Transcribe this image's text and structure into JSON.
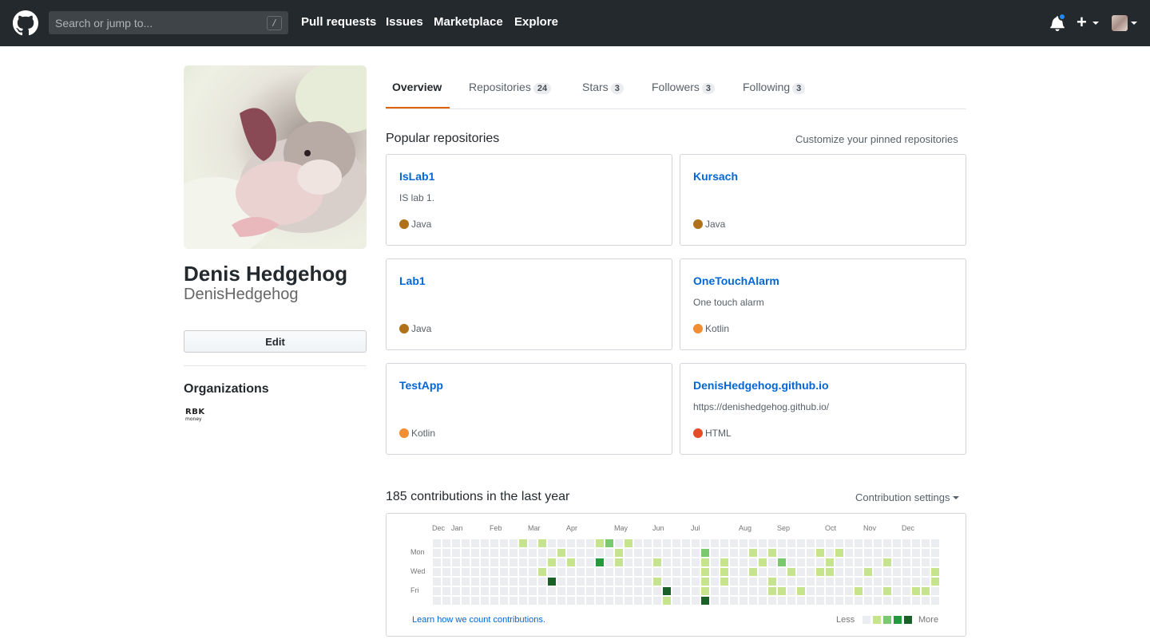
{
  "header": {
    "search_placeholder": "Search or jump to...",
    "search_shortcut": "/",
    "nav": [
      "Pull requests",
      "Issues",
      "Marketplace",
      "Explore"
    ],
    "plus_label": "+"
  },
  "profile": {
    "full_name": "Denis Hedgehog",
    "username": "DenisHedgehog",
    "edit_label": "Edit",
    "organizations_title": "Organizations",
    "org_logo_text": "RBK",
    "org_logo_sub": "money"
  },
  "tabs": [
    {
      "label": "Overview",
      "count": null
    },
    {
      "label": "Repositories",
      "count": "24"
    },
    {
      "label": "Stars",
      "count": "3"
    },
    {
      "label": "Followers",
      "count": "3"
    },
    {
      "label": "Following",
      "count": "3"
    }
  ],
  "popular": {
    "title": "Popular repositories",
    "customize_label": "Customize your pinned repositories",
    "repos": [
      {
        "name": "IsLab1",
        "description": "IS lab 1.",
        "language": "Java",
        "lang_color": "#b07219"
      },
      {
        "name": "Kursach",
        "description": "",
        "language": "Java",
        "lang_color": "#b07219"
      },
      {
        "name": "Lab1",
        "description": "",
        "language": "Java",
        "lang_color": "#b07219"
      },
      {
        "name": "OneTouchAlarm",
        "description": "One touch alarm",
        "language": "Kotlin",
        "lang_color": "#F18E33"
      },
      {
        "name": "TestApp",
        "description": "",
        "language": "Kotlin",
        "lang_color": "#F18E33"
      },
      {
        "name": "DenisHedgehog.github.io",
        "description": "https://denishedgehog.github.io/",
        "language": "HTML",
        "lang_color": "#e34c26"
      }
    ]
  },
  "contributions": {
    "title": "185 contributions in the last year",
    "settings_label": "Contribution settings",
    "months": [
      "Dec",
      "Jan",
      "Feb",
      "Mar",
      "Apr",
      "May",
      "Jun",
      "Jul",
      "Aug",
      "Sep",
      "Oct",
      "Nov",
      "Dec"
    ],
    "weekdays": [
      "Mon",
      "Wed",
      "Fri"
    ],
    "learn_link": "Learn how we count contributions.",
    "legend_less": "Less",
    "legend_more": "More",
    "level_colors": [
      "#ebedf0",
      "#c6e48b",
      "#7bc96f",
      "#239a3b",
      "#196127"
    ],
    "active_cells": [
      [
        9,
        0,
        1
      ],
      [
        11,
        0,
        1
      ],
      [
        17,
        0,
        1
      ],
      [
        18,
        0,
        2
      ],
      [
        20,
        0,
        1
      ],
      [
        13,
        1,
        1
      ],
      [
        19,
        1,
        1
      ],
      [
        28,
        1,
        2
      ],
      [
        33,
        1,
        1
      ],
      [
        35,
        1,
        1
      ],
      [
        40,
        1,
        1
      ],
      [
        42,
        1,
        1
      ],
      [
        53,
        1,
        1
      ],
      [
        54,
        1,
        1
      ],
      [
        12,
        2,
        1
      ],
      [
        14,
        2,
        1
      ],
      [
        17,
        2,
        3
      ],
      [
        19,
        2,
        1
      ],
      [
        23,
        2,
        1
      ],
      [
        28,
        2,
        1
      ],
      [
        30,
        2,
        1
      ],
      [
        34,
        2,
        1
      ],
      [
        36,
        2,
        2
      ],
      [
        41,
        2,
        1
      ],
      [
        47,
        2,
        1
      ],
      [
        54,
        2,
        1
      ],
      [
        11,
        3,
        1
      ],
      [
        28,
        3,
        1
      ],
      [
        30,
        3,
        1
      ],
      [
        33,
        3,
        1
      ],
      [
        37,
        3,
        1
      ],
      [
        40,
        3,
        1
      ],
      [
        41,
        3,
        1
      ],
      [
        45,
        3,
        1
      ],
      [
        52,
        3,
        1
      ],
      [
        55,
        3,
        1
      ],
      [
        12,
        4,
        4
      ],
      [
        23,
        4,
        1
      ],
      [
        28,
        4,
        1
      ],
      [
        30,
        4,
        1
      ],
      [
        35,
        4,
        1
      ],
      [
        52,
        4,
        1
      ],
      [
        24,
        5,
        4
      ],
      [
        28,
        5,
        1
      ],
      [
        35,
        5,
        1
      ],
      [
        36,
        5,
        1
      ],
      [
        38,
        5,
        1
      ],
      [
        44,
        5,
        1
      ],
      [
        47,
        5,
        1
      ],
      [
        50,
        5,
        1
      ],
      [
        51,
        5,
        1
      ],
      [
        53,
        5,
        1
      ],
      [
        24,
        6,
        1
      ],
      [
        28,
        6,
        4
      ]
    ]
  }
}
